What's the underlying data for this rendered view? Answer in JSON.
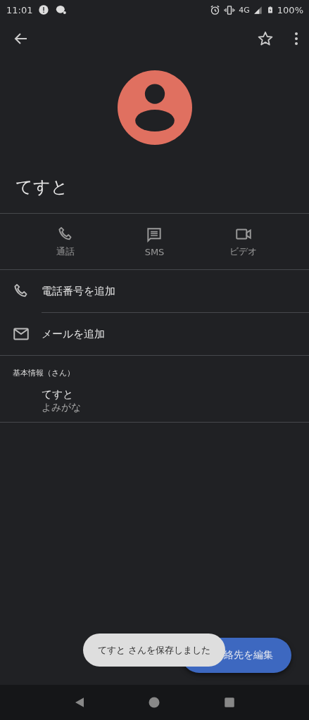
{
  "status_bar": {
    "time": "11:01",
    "battery": "100%",
    "network": "4G"
  },
  "contact": {
    "name": "てすと"
  },
  "actions": [
    {
      "kind": "call",
      "label": "通話"
    },
    {
      "kind": "sms",
      "label": "SMS"
    },
    {
      "kind": "video",
      "label": "ビデオ"
    }
  ],
  "rows": [
    {
      "kind": "phone",
      "label": "電話番号を追加"
    },
    {
      "kind": "email",
      "label": "メールを追加"
    }
  ],
  "section": {
    "title": "基本情報（さん）",
    "name": "てすと",
    "reading": "よみがな"
  },
  "fab": {
    "label": "絡先を編集"
  },
  "toast": {
    "text": "てすと さんを保存しました"
  }
}
